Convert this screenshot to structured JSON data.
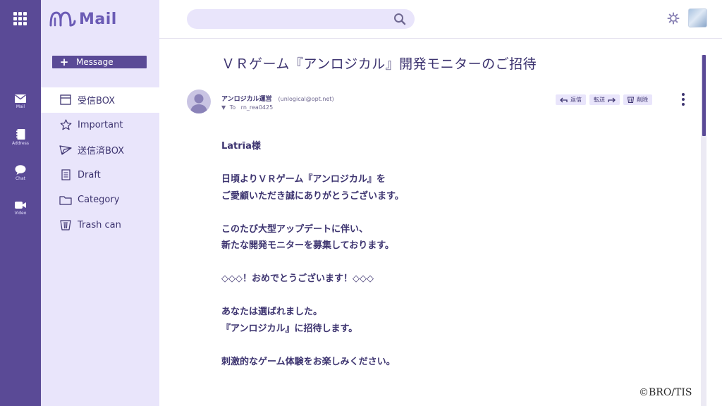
{
  "app": {
    "logo_text": "Mail"
  },
  "rail": {
    "items": [
      {
        "label": "Mail",
        "icon": "mail-icon"
      },
      {
        "label": "Address",
        "icon": "address-book-icon"
      },
      {
        "label": "Chat",
        "icon": "chat-icon"
      },
      {
        "label": "Video",
        "icon": "video-icon"
      }
    ]
  },
  "compose": {
    "label": "Message"
  },
  "folders": [
    {
      "label": "受信BOX",
      "icon": "inbox-icon",
      "active": true
    },
    {
      "label": "Important",
      "icon": "star-icon"
    },
    {
      "label": "送信済BOX",
      "icon": "sent-icon"
    },
    {
      "label": "Draft",
      "icon": "draft-icon"
    },
    {
      "label": "Category",
      "icon": "folder-icon"
    },
    {
      "label": "Trash can",
      "icon": "trash-icon"
    }
  ],
  "search": {
    "placeholder": ""
  },
  "message": {
    "subject": "ＶＲゲーム『アンロジカル』開発モニターのご招待",
    "sender_name": "アンロジカル運営",
    "sender_email": "(unlogical@opt.net)",
    "to_label": "To",
    "to_address": "rn_rea0425",
    "actions": {
      "reply": "返信",
      "forward": "転送",
      "delete": "削除"
    },
    "body": {
      "greeting": "Latrīa様",
      "p1_l1": "日頃よりＶＲゲーム『アンロジカル』を",
      "p1_l2": "ご愛顧いただき誠にありがとうございます。",
      "p2_l1": "このたび大型アップデートに伴い、",
      "p2_l2": "新たな開発モニターを募集しております。",
      "p3": "◇◇◇！おめでとうございます！◇◇◇",
      "p4_l1": "あなたは選ばれました。",
      "p4_l2": "『アンロジカル』に招待します。",
      "p5": "刺激的なゲーム体験をお楽しみください。"
    }
  },
  "footer": {
    "copyright": "©BRO/TIS"
  },
  "colors": {
    "primary": "#5a4a96",
    "sidebar_bg": "#e9e5fb",
    "text": "#3d3470"
  }
}
